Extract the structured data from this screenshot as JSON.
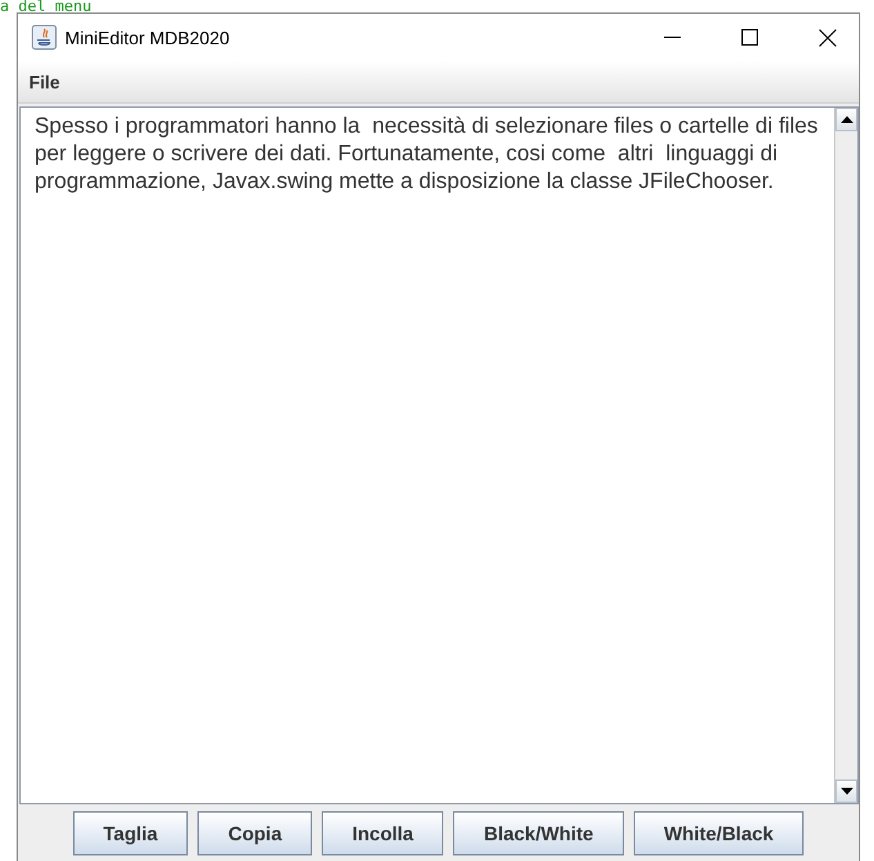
{
  "background_text": "a del menu",
  "window": {
    "title": "MiniEditor MDB2020"
  },
  "menu": [
    "File"
  ],
  "editor": {
    "value": "Spesso i programmatori hanno la  necessità di selezionare files o cartelle di files per leggere o scrivere dei dati. Fortunatamente, cosi come  altri  linguaggi di programmazione, Javax.swing mette a disposizione la classe JFileChooser."
  },
  "buttons": [
    "Taglia",
    "Copia",
    "Incolla",
    "Black/White",
    "White/Black"
  ]
}
